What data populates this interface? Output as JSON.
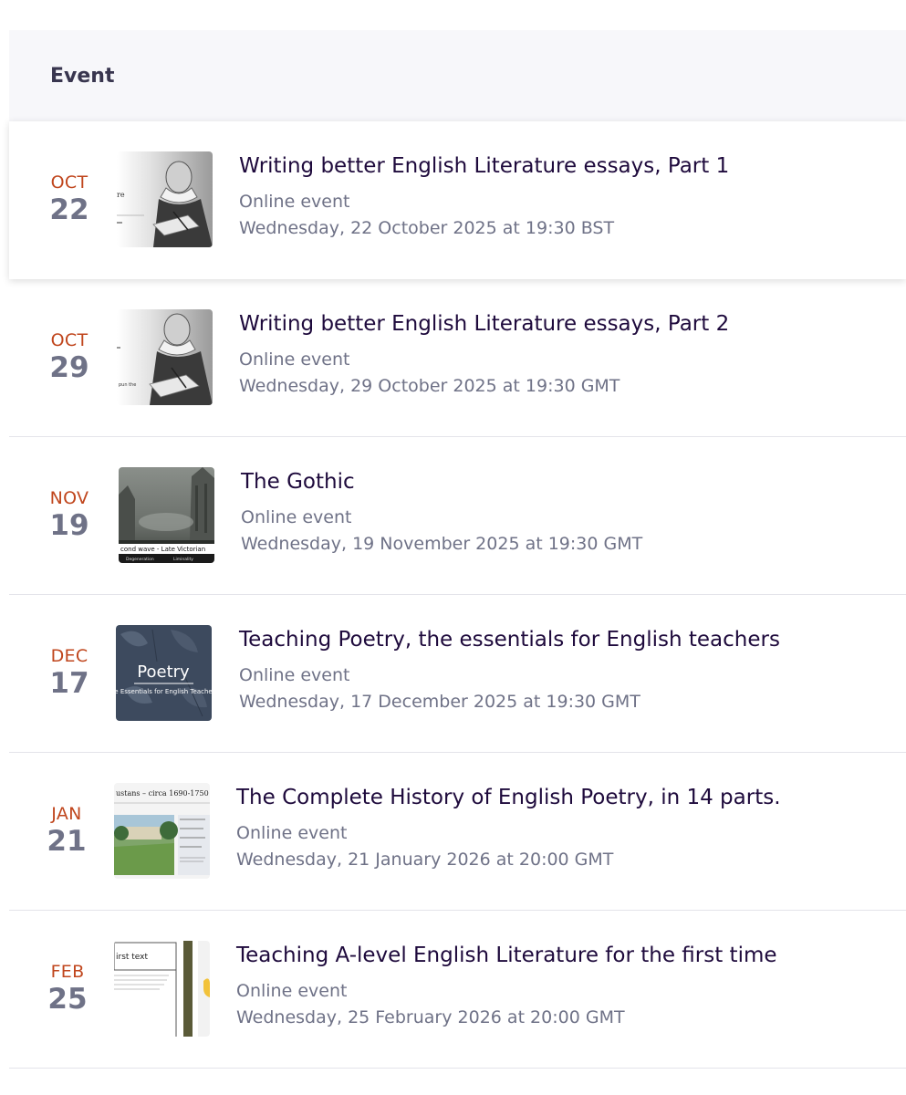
{
  "header": {
    "title": "Event"
  },
  "events": [
    {
      "month": "OCT",
      "day": "22",
      "title": "Writing better English Literature essays, Part 1",
      "location": "Online event",
      "datetime": "Wednesday, 22 October 2025 at 19:30 BST",
      "thumbnail": "shakespeare-engraving-icon",
      "thumb_text": "re"
    },
    {
      "month": "OCT",
      "day": "29",
      "title": "Writing better English Literature essays, Part 2",
      "location": "Online event",
      "datetime": "Wednesday, 29 October 2025 at 19:30 GMT",
      "thumbnail": "shakespeare-engraving-icon",
      "thumb_text": "pun the"
    },
    {
      "month": "NOV",
      "day": "19",
      "title": "The Gothic",
      "location": "Online event",
      "datetime": "Wednesday, 19 November 2025 at 19:30 GMT",
      "thumbnail": "gothic-scene-icon",
      "thumb_text": "cond wave - Late Victorian",
      "thumb_text_2": "Degeneration",
      "thumb_text_3": "Liminality"
    },
    {
      "month": "DEC",
      "day": "17",
      "title": "Teaching Poetry, the essentials for English teachers",
      "location": "Online event",
      "datetime": "Wednesday, 17 December 2025 at 19:30 GMT",
      "thumbnail": "poetry-leaves-icon",
      "thumb_text": "Poetry",
      "thumb_text_2": "e Essentials for English Teache"
    },
    {
      "month": "JAN",
      "day": "21",
      "title": "The Complete History of English Poetry, in 14 parts.",
      "location": "Online event",
      "datetime": "Wednesday, 21 January 2026 at 20:00 GMT",
      "thumbnail": "augustans-slide-icon",
      "thumb_text": "ustans – circa 1690-1750"
    },
    {
      "month": "FEB",
      "day": "25",
      "title": "Teaching A-level English Literature for the first time",
      "location": "Online event",
      "datetime": "Wednesday, 25 February 2026 at 20:00 GMT",
      "thumbnail": "first-text-slide-icon",
      "thumb_text": "irst text"
    }
  ],
  "colors": {
    "month_accent": "#c0461d",
    "title_text": "#1e0a3c",
    "meta_text": "#6f7287",
    "header_bg": "#f7f7fa"
  }
}
